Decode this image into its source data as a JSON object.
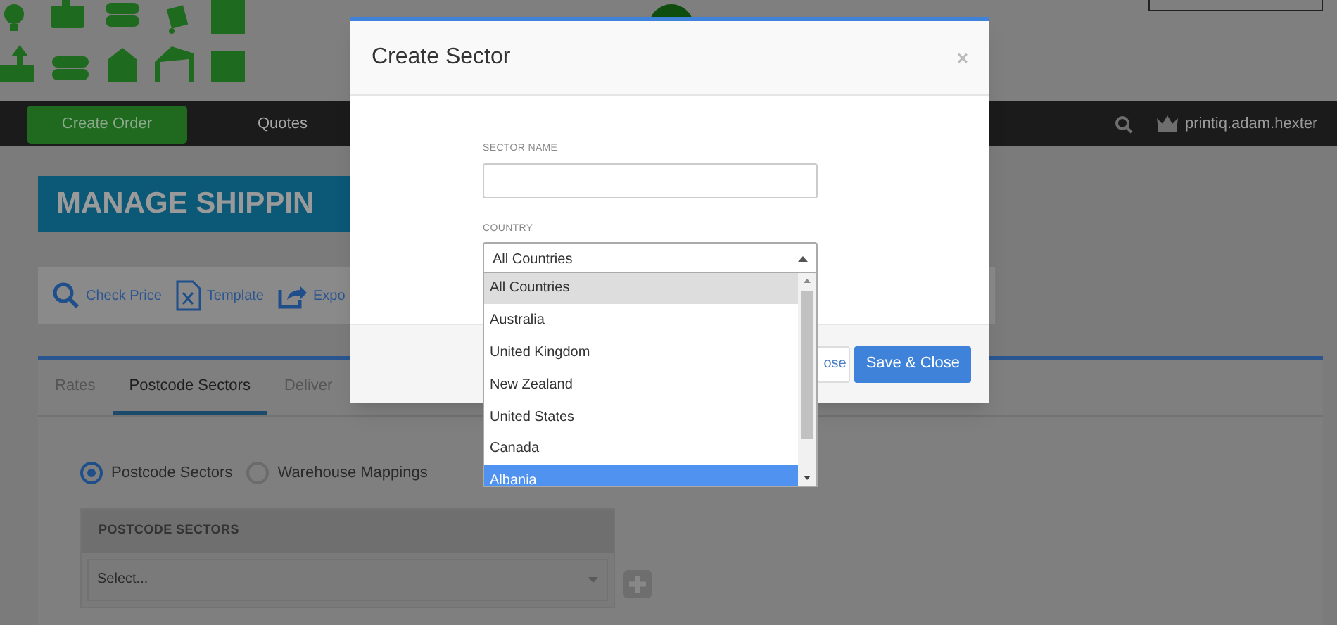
{
  "header": {
    "nav": [
      {
        "label": "Create Order",
        "kind": "button"
      },
      {
        "label": "Quotes",
        "kind": "link"
      }
    ],
    "username": "printiq.adam.hexter"
  },
  "page": {
    "title": "MANAGE SHIPPIN",
    "toolbar": [
      {
        "label": "Check Price",
        "kind": "search"
      },
      {
        "label": "Template",
        "kind": "sheet"
      },
      {
        "label": "Expo",
        "kind": "export"
      }
    ],
    "tabs": [
      {
        "label": "Rates",
        "selected": false
      },
      {
        "label": "Postcode Sectors",
        "selected": true
      },
      {
        "label": "Deliver",
        "selected": false
      }
    ],
    "mode_options": [
      {
        "label": "Postcode Sectors",
        "selected": true
      },
      {
        "label": "Warehouse Mappings",
        "selected": false
      }
    ],
    "sectors_table": {
      "header": "POSTCODE SECTORS",
      "select": {
        "placeholder": "Select..."
      }
    }
  },
  "modal": {
    "title": "Create Sector",
    "close": "×",
    "fields": [
      {
        "label": "SECTOR NAME",
        "kind": "text"
      },
      {
        "label": "COUNTRY",
        "kind": "select",
        "value": "All Countries",
        "expanded": true
      }
    ],
    "country_options": [
      {
        "label": "All Countries",
        "selected": true,
        "highlighted": false
      },
      {
        "label": "Australia",
        "selected": false,
        "highlighted": false
      },
      {
        "label": "United Kingdom",
        "selected": false,
        "highlighted": false
      },
      {
        "label": "New Zealand",
        "selected": false,
        "highlighted": false
      },
      {
        "label": "United States",
        "selected": false,
        "highlighted": false
      },
      {
        "label": "Canada",
        "selected": false,
        "highlighted": false
      },
      {
        "label": "Albania",
        "selected": false,
        "highlighted": true
      }
    ],
    "buttons": [
      {
        "label": "ose",
        "kind": "secondary"
      },
      {
        "label": "Save & Close",
        "kind": "primary"
      }
    ]
  }
}
